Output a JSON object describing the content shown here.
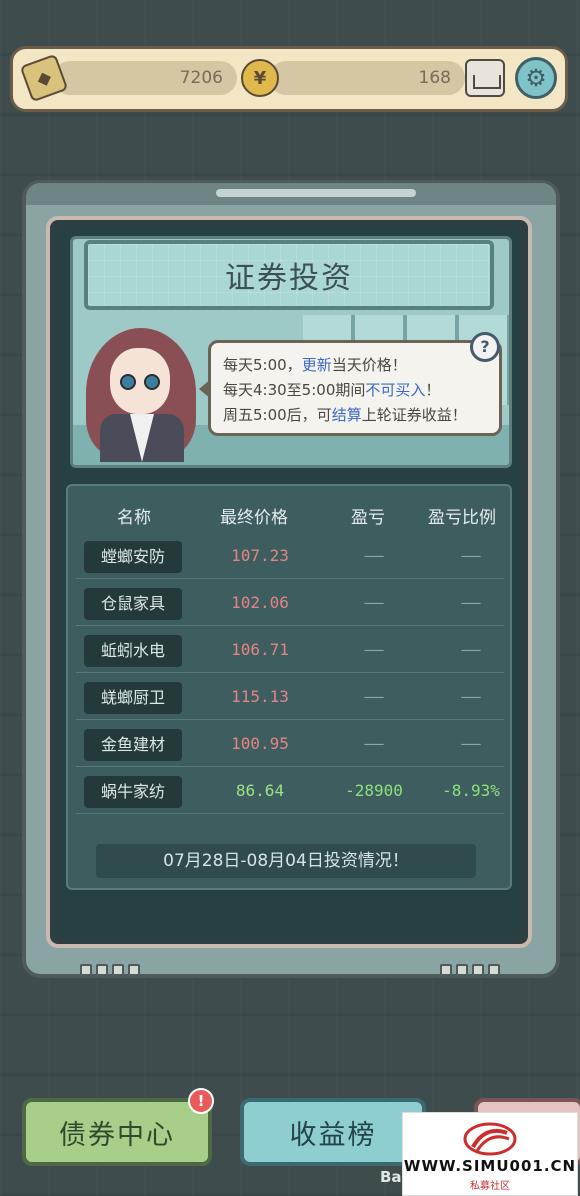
{
  "topbar": {
    "ticket_count": "7206",
    "coin_count": "168",
    "coin_symbol": "¥",
    "icons": [
      "ticket-icon",
      "coin-icon",
      "mail-icon",
      "gear-icon"
    ]
  },
  "panel": {
    "title": "证券投资",
    "help_symbol": "?",
    "tips": {
      "line1_a": "每天5:00，",
      "line1_hl": "更新",
      "line1_b": "当天价格！",
      "line2_a": "每天4:30至5:00期间",
      "line2_hl": "不可买入",
      "line2_b": "！",
      "line3_a": "周五5:00后，可",
      "line3_hl": "结算",
      "line3_b": "上轮证券收益！"
    },
    "table": {
      "headers": [
        "名称",
        "最终价格",
        "盈亏",
        "盈亏比例"
      ],
      "rows": [
        {
          "name": "螳螂安防",
          "price": "107.23",
          "pnl": "——",
          "pct": "——"
        },
        {
          "name": "仓鼠家具",
          "price": "102.06",
          "pnl": "——",
          "pct": "——"
        },
        {
          "name": "蚯蚓水电",
          "price": "106.71",
          "pnl": "——",
          "pct": "——"
        },
        {
          "name": "蜣螂厨卫",
          "price": "115.13",
          "pnl": "——",
          "pct": "——"
        },
        {
          "name": "金鱼建材",
          "price": "100.95",
          "pnl": "——",
          "pct": "——"
        },
        {
          "name": "蜗牛家纺",
          "price": "86.64",
          "pnl": "-28900",
          "pct": "-8.93%"
        }
      ]
    },
    "period_label": "07月28日-08月04日投资情况！"
  },
  "bottom": {
    "bond_center": "债券中心",
    "bond_badge": "!",
    "income_rank": "收益榜",
    "partial_label": "Ba"
  },
  "watermark": {
    "url": "WWW.SIMU001.CN",
    "sub": "私募社区"
  },
  "colors": {
    "price_red": "#e38585",
    "price_green": "#9fe089",
    "link_blue": "#3d67c9"
  }
}
